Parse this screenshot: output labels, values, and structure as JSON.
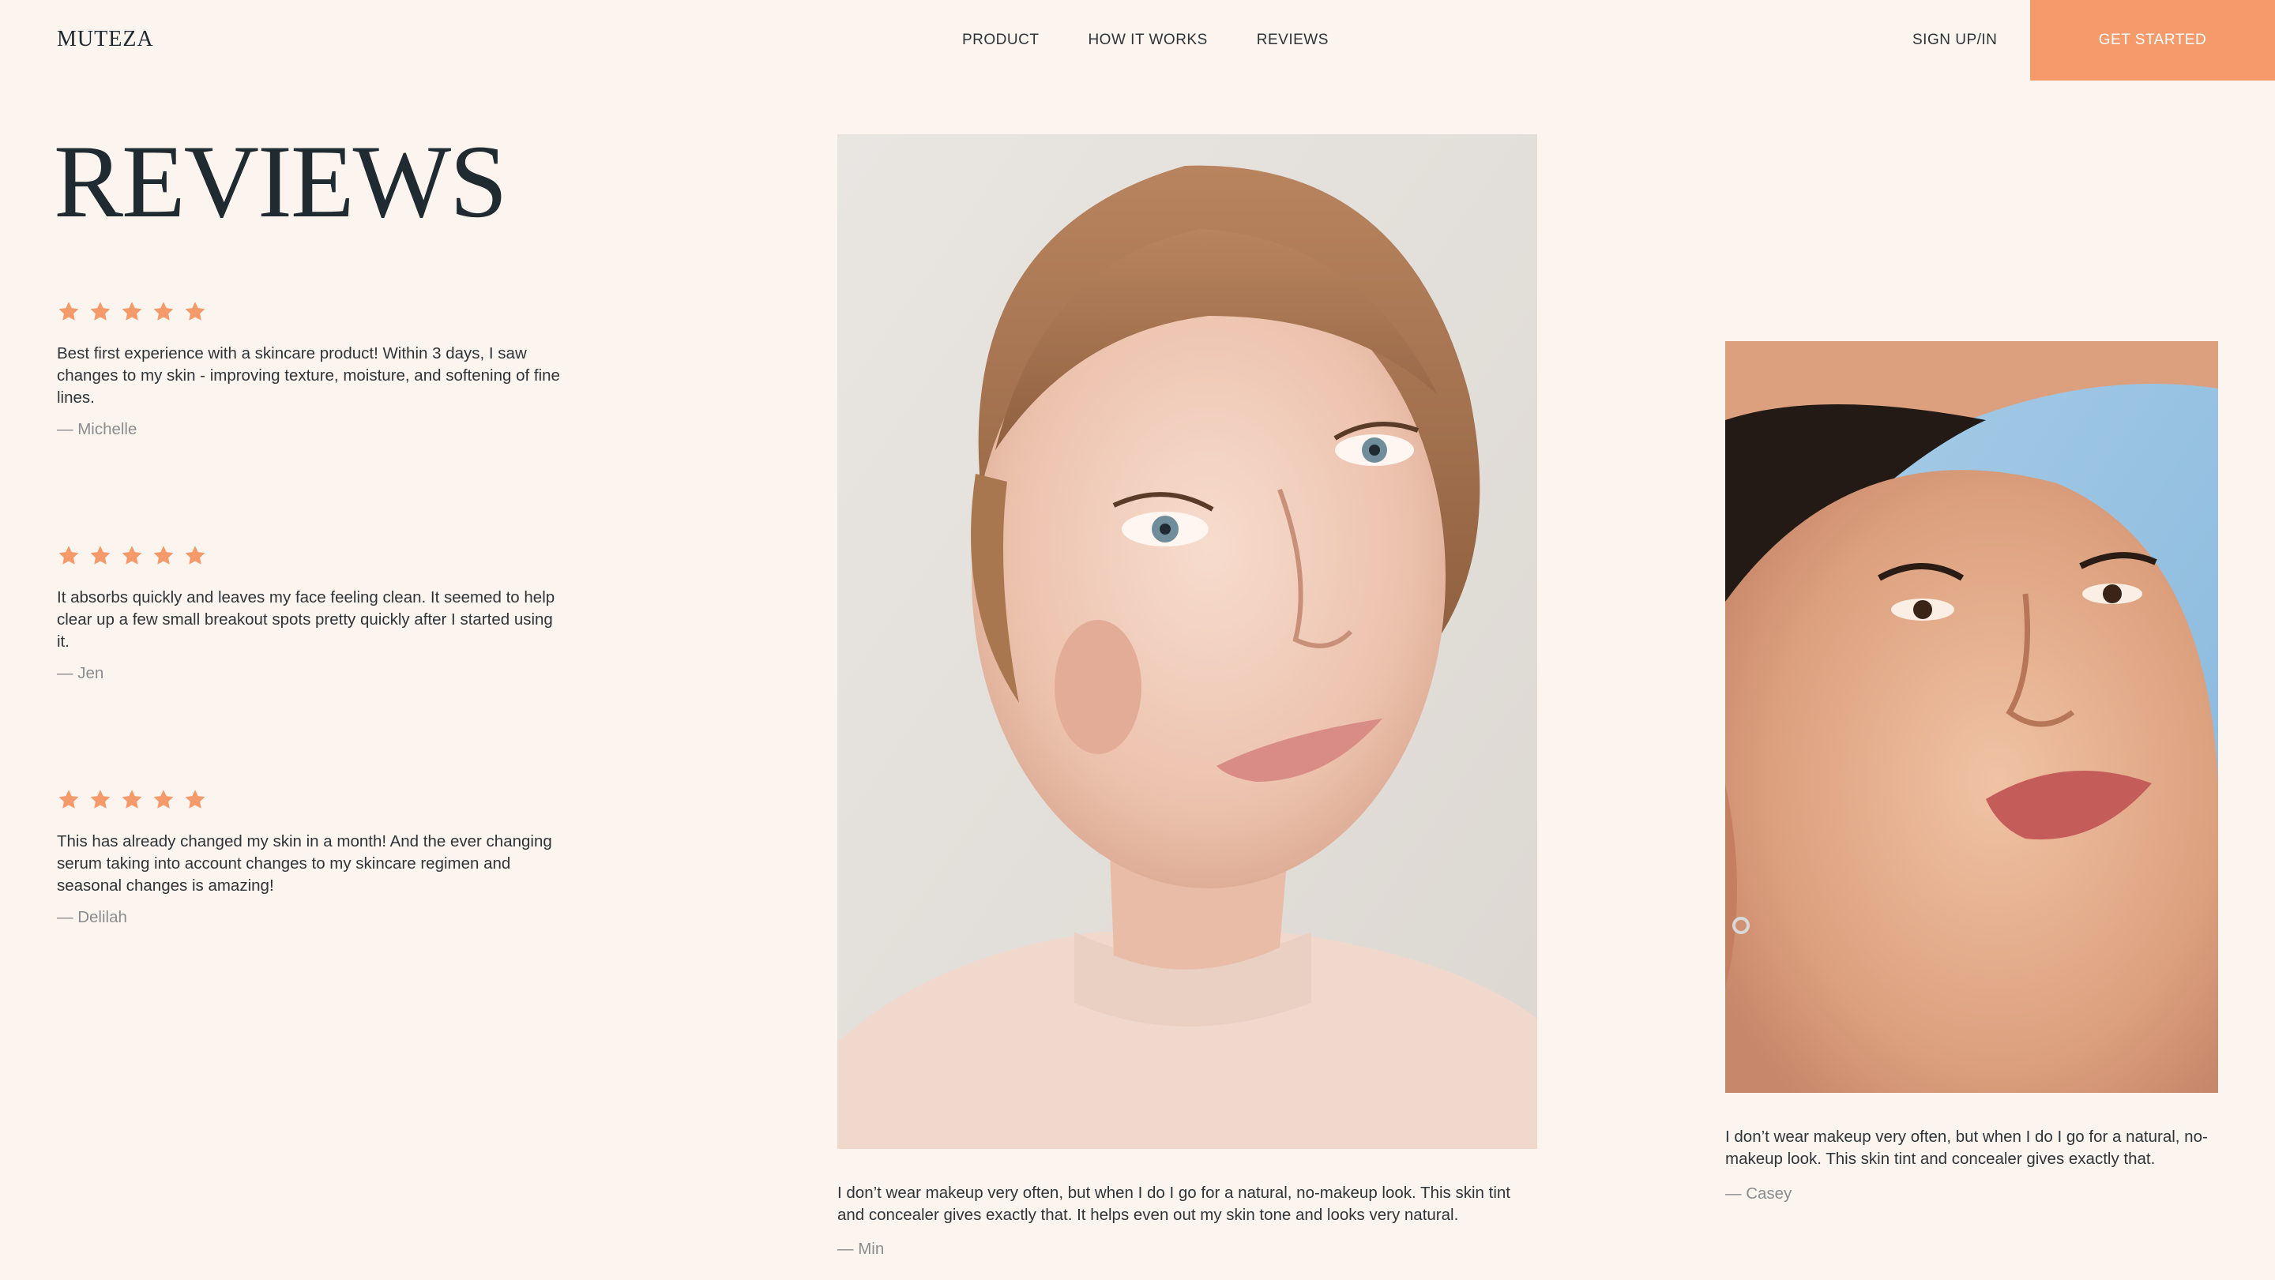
{
  "header": {
    "logo": "MUTEZA",
    "nav": [
      "PRODUCT",
      "HOW IT WORKS",
      "REVIEWS"
    ],
    "signup": "SIGN UP/IN",
    "cta": "GET STARTED"
  },
  "page_title": "REVIEWS",
  "colors": {
    "accent": "#f59a6b",
    "background": "#fcf5ef",
    "text": "#1f2b31"
  },
  "reviews": [
    {
      "rating": 5,
      "text": "Best first experience with a skincare product! Within 3 days, I saw changes to my skin - improving texture, moisture, and softening of fine lines.",
      "author": "— Michelle"
    },
    {
      "rating": 5,
      "text": "It absorbs quickly and leaves my face feeling clean. It seemed to help clear up a few small breakout spots pretty quickly after I started using it.",
      "author": "— Jen"
    },
    {
      "rating": 5,
      "text": "This has already changed my skin in a month! And the ever changing serum taking into account changes to my skincare regimen and seasonal changes is amazing!",
      "author": "— Delilah"
    }
  ],
  "photo_reviews": [
    {
      "text": "I don’t wear makeup very often, but when I do I go for a natural, no-makeup look. This skin tint and concealer gives exactly that. It helps even out my skin tone and looks very natural.",
      "author": "— Min"
    },
    {
      "text": "I don’t wear makeup very often, but when I do I go for a natural, no-makeup look. This skin tint and concealer gives exactly that.",
      "author": "— Casey"
    }
  ]
}
